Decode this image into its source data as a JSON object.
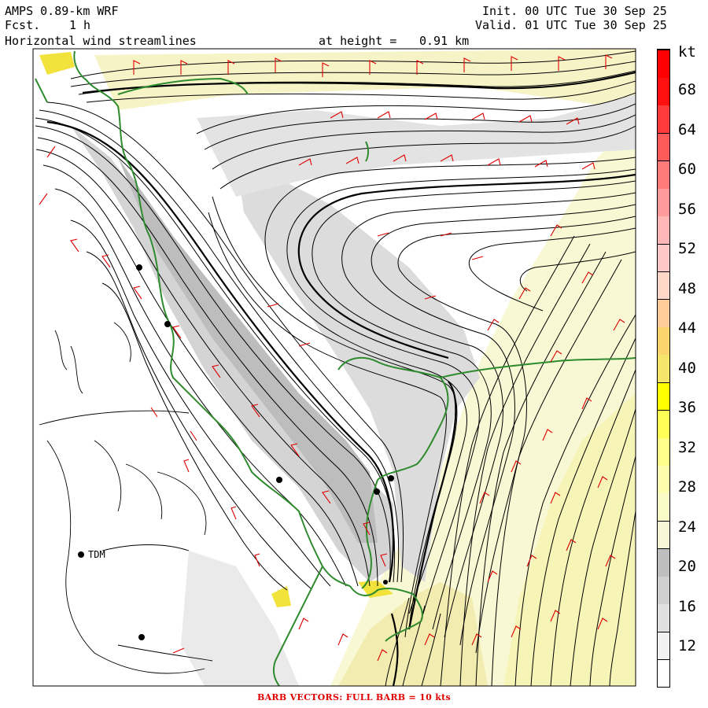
{
  "header": {
    "model": "AMPS 0.89-km WRF",
    "fcst_label": "Fcst.",
    "fcst_value": "1 h",
    "field": "Horizontal wind streamlines",
    "height_label": "at height =",
    "height_value": "0.91 km",
    "init": "Init. 00 UTC Tue 30 Sep 25",
    "valid": "Valid. 01 UTC Tue 30 Sep 25"
  },
  "legend": {
    "unit": "kt",
    "labels": [
      "68",
      "64",
      "60",
      "56",
      "52",
      "48",
      "44",
      "40",
      "36",
      "32",
      "28",
      "24",
      "20",
      "16",
      "12"
    ],
    "colors": [
      "#ffffff",
      "#f2f2f2",
      "#e0e0e0",
      "#cfcfcf",
      "#bebebe",
      "#f7f7d6",
      "#fbfbc8",
      "#fdfdae",
      "#ffff8a",
      "#ffff55",
      "#ffff00",
      "#f5e66b",
      "#fbd46e",
      "#ffcc99",
      "#ffd7c8",
      "#ffc8c8",
      "#ffb6b6",
      "#ff9a9a",
      "#ff7a7a",
      "#ff5a5a",
      "#ff3a3a",
      "#ff1010",
      "#ff0000"
    ]
  },
  "stations": [
    {
      "name": "TDM"
    }
  ],
  "footer": "BARB VECTORS:  FULL BARB = 10 kts",
  "colors": {
    "coast": "#2e8b2e",
    "barb": "#e00000",
    "streamline": "#000000"
  }
}
